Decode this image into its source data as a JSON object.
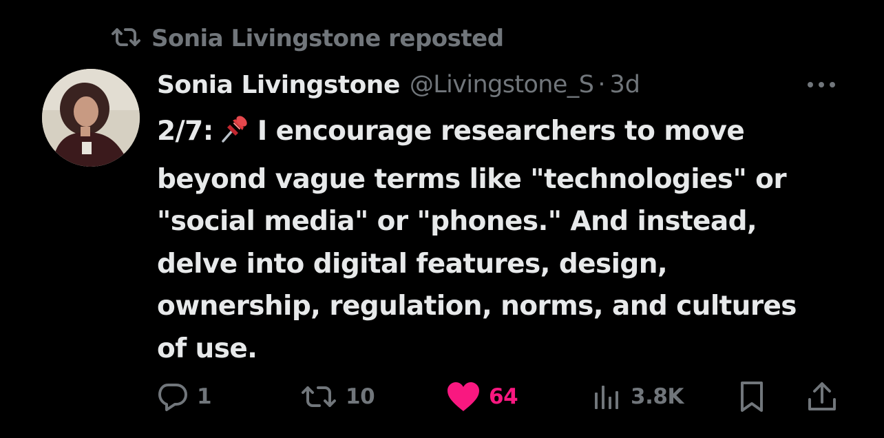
{
  "repost_banner": {
    "label": "Sonia Livingstone reposted",
    "icon": "repost-icon"
  },
  "tweet": {
    "author_name": "Sonia Livingstone",
    "handle": "@Livingstone_S",
    "separator": "·",
    "time": "3d",
    "text_lines": [
      {
        "before": "2/7:",
        "emoji": "pushpin",
        "after": "I encourage researchers to move"
      },
      "beyond vague terms like \"technologies\" or",
      "\"social media\" or \"phones.\" And instead,",
      "delve into digital features, design,",
      "ownership, regulation, norms, and cultures",
      "of use."
    ]
  },
  "actions": {
    "reply": {
      "icon": "reply-icon",
      "count": "1"
    },
    "repost": {
      "icon": "repost-icon",
      "count": "10"
    },
    "like": {
      "icon": "heart-icon",
      "count": "64",
      "active": true
    },
    "views": {
      "icon": "views-icon",
      "count": "3.8K"
    },
    "bookmark": {
      "icon": "bookmark-icon"
    },
    "share": {
      "icon": "share-icon"
    }
  },
  "colors": {
    "background": "#000000",
    "primary_text": "#e7e9ea",
    "secondary_text": "#71767b",
    "like_active": "#f91880"
  }
}
